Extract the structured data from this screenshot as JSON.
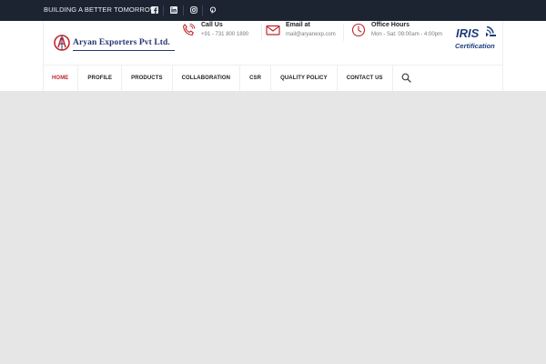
{
  "topbar": {
    "tagline": "BUILDING A BETTER TOMORROW",
    "social_icons": [
      "facebook-icon",
      "linkedin-icon",
      "instagram-icon",
      "pinterest-icon"
    ],
    "background": "#1c2431"
  },
  "logo": {
    "text": "Aryan Exporters Pvt Ltd.",
    "brand_color": "#283573",
    "accent_color": "#c0262d"
  },
  "contact": [
    {
      "title": "Call Us",
      "detail": "+91 - 731 800 1890",
      "icon": "phone-icon"
    },
    {
      "title": "Email at",
      "detail": "mail@aryanexp.com",
      "icon": "mail-icon"
    },
    {
      "title": "Office Hours",
      "detail": "Mon - Sat: 09:00am - 4:00pm",
      "icon": "clock-icon"
    }
  ],
  "certification": {
    "brand": "IRIS",
    "label": "Certification"
  },
  "nav": {
    "items": [
      "HOME",
      "PROFILE",
      "PRODUCTS",
      "COLLABORATION",
      "CSR",
      "QUALITY POLICY",
      "CONTACT US"
    ],
    "active_index": 0,
    "active_color": "#c0262d"
  }
}
